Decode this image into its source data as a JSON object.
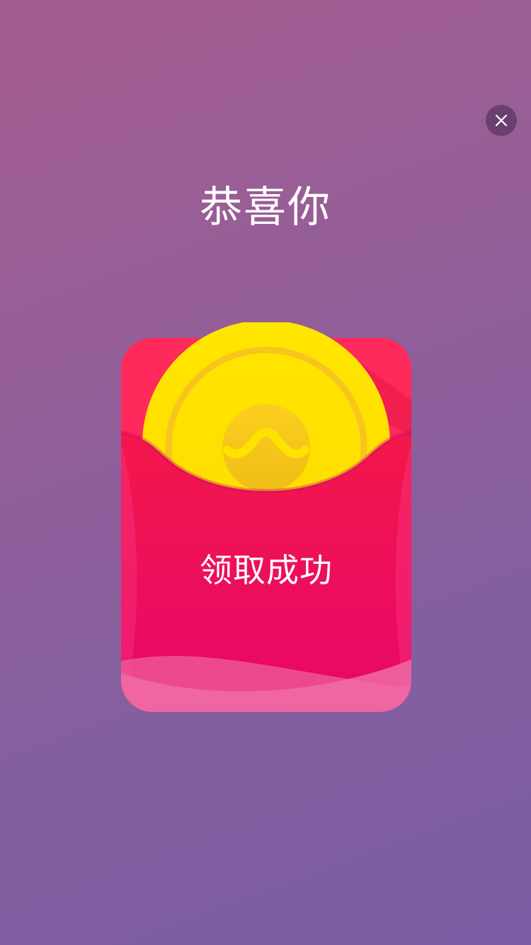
{
  "dialog": {
    "title": "恭喜你",
    "status": "领取成功",
    "close_icon": "close-icon",
    "coin_icon": "coin-icon"
  },
  "colors": {
    "background_top": "#a55d90",
    "background_bottom": "#7b5ea4",
    "envelope_red": "#ee1552",
    "envelope_pink_bottom": "#ee6aa6",
    "coin_yellow": "#ffe300",
    "coin_ring": "#f8c51c"
  }
}
